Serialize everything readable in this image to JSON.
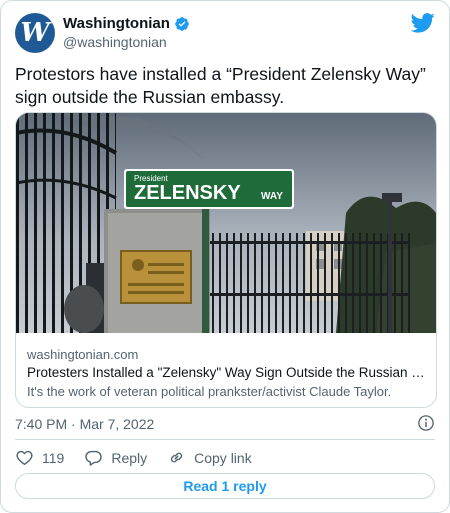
{
  "account": {
    "avatar_letter": "W",
    "display_name": "Washingtonian",
    "handle": "@washingtonian",
    "avatar_color": "#1f5a96"
  },
  "tweet": {
    "text": "Protestors have installed a “President Zelensky Way” sign outside the Russian embassy.",
    "timestamp": "7:40 PM · Mar 7, 2022"
  },
  "link_card": {
    "sign_small": "President",
    "sign_main": "ZELENSKY",
    "sign_suffix": "WAY",
    "domain": "washingtonian.com",
    "title": "Protesters Installed a \"Zelensky\" Way Sign Outside the Russian Embassy",
    "description": "It's the work of veteran political prankster/activist Claude Taylor."
  },
  "actions": {
    "likes": "119",
    "reply_label": "Reply",
    "copy_link_label": "Copy link"
  },
  "read_replies_label": "Read 1 reply",
  "colors": {
    "brand": "#1d9bf0",
    "text": "#0f1419",
    "muted": "#536471",
    "border": "#cfd9de",
    "sign_green": "#1f6b3a"
  },
  "icons": [
    "verified-badge-icon",
    "twitter-bird-icon",
    "info-icon",
    "heart-icon",
    "reply-icon",
    "link-icon"
  ]
}
